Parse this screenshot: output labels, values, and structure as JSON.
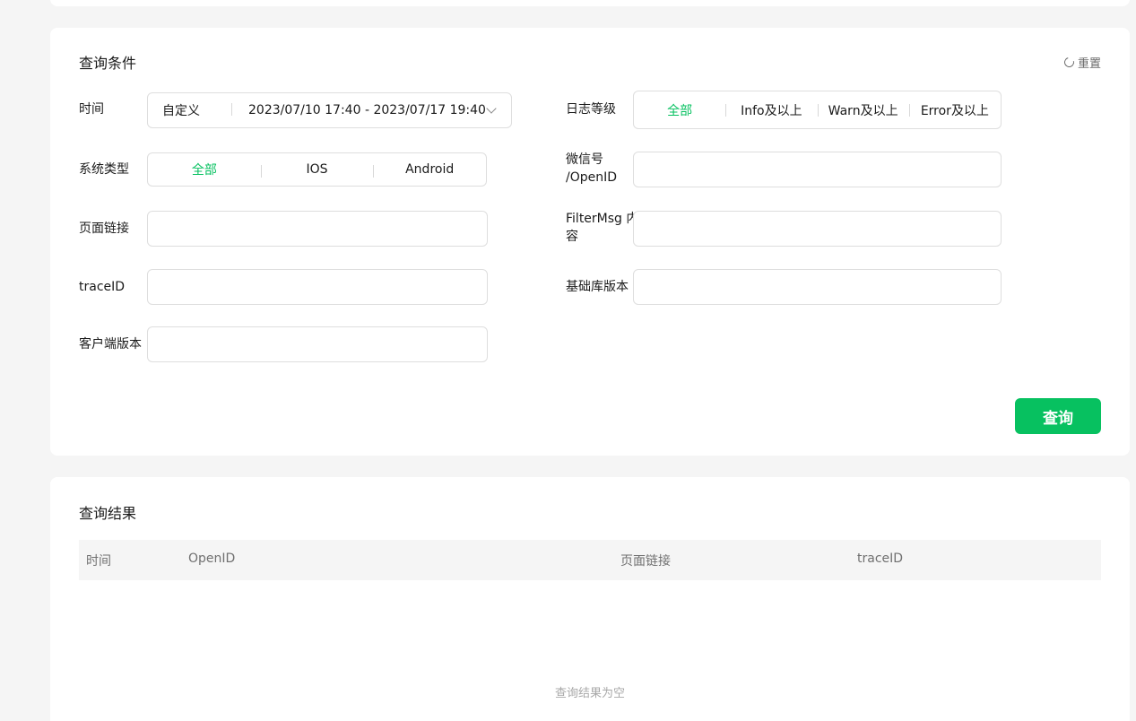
{
  "query": {
    "title": "查询条件",
    "reset_label": "重置",
    "time": {
      "label": "时间",
      "mode": "自定义",
      "range": "2023/07/10 17:40 - 2023/07/17 19:40"
    },
    "log_level": {
      "label": "日志等级",
      "options": [
        "全部",
        "Info及以上",
        "Warn及以上",
        "Error及以上"
      ],
      "selected": 0
    },
    "system_type": {
      "label": "系统类型",
      "options": [
        "全部",
        "IOS",
        "Android"
      ],
      "selected": 0
    },
    "wechat_id": {
      "label_line1": "微信号",
      "label_line2": "/OpenID",
      "value": ""
    },
    "page_link": {
      "label": "页面链接",
      "value": ""
    },
    "filter_msg": {
      "label_line1": "FilterMsg 内",
      "label_line2": "容",
      "value": ""
    },
    "trace_id": {
      "label": "traceID",
      "value": ""
    },
    "base_lib_version": {
      "label": "基础库版本",
      "value": ""
    },
    "client_version": {
      "label": "客户端版本",
      "value": ""
    },
    "submit_label": "查询"
  },
  "results": {
    "title": "查询结果",
    "columns": [
      "时间",
      "OpenID",
      "页面链接",
      "traceID"
    ],
    "empty_text": "查询结果为空"
  },
  "colors": {
    "accent": "#07c160",
    "page_bg": "#f5f5f5"
  }
}
